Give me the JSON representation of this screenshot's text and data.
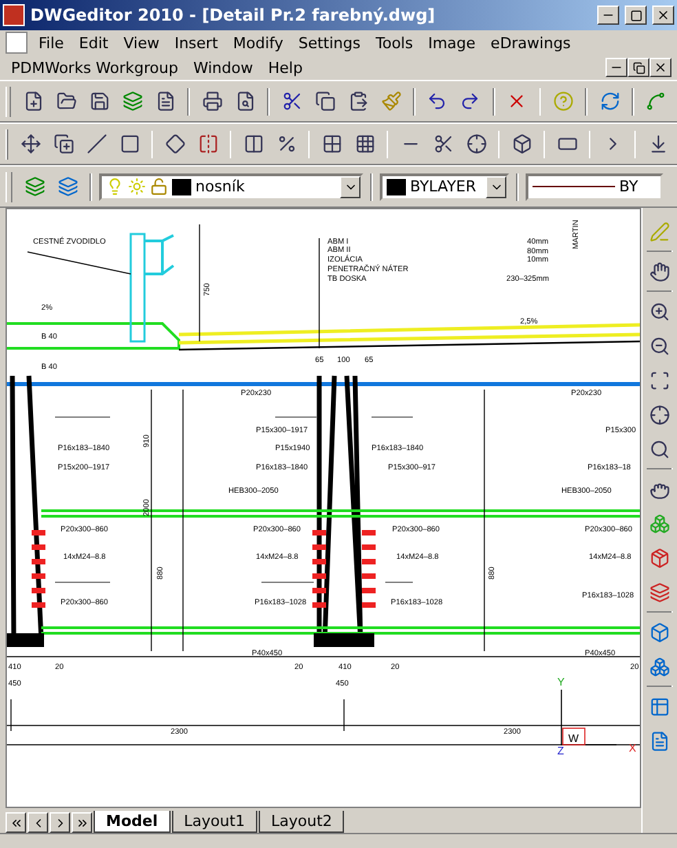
{
  "window": {
    "title": "DWGeditor 2010 - [Detail Pr.2 farebný.dwg]"
  },
  "menu_rows": [
    [
      "File",
      "Edit",
      "View",
      "Insert",
      "Modify",
      "Settings",
      "Tools",
      "Image",
      "eDrawings"
    ],
    [
      "PDMWorks Workgroup",
      "Window",
      "Help"
    ]
  ],
  "properties_bar": {
    "layer": "nosník",
    "color_setting": "BYLAYER",
    "linetype": "BY"
  },
  "drawing": {
    "annotations": [
      "CESTNÉ ZVODIDLO",
      "ABM I",
      "ABM II",
      "IZOLÁCIA",
      "PENETRAČNÝ NÁTER",
      "TB DOSKA",
      "40mm",
      "80mm",
      "10mm",
      "230–325mm",
      "MARTIN",
      "750",
      "2%",
      "2,5%",
      "B 40",
      "B 40",
      "65",
      "100",
      "65",
      "P20x230",
      "P20x230",
      "P15x300–1917",
      "P15x300",
      "P16x183–1840",
      "P15x1940",
      "P16x183–1840",
      "P15x200–1917",
      "P16x183–1840",
      "P15x300–917",
      "P16x183–18",
      "HEB300–2050",
      "HEB300–2050",
      "910",
      "2000",
      "P20x300–860",
      "P20x300–860",
      "P20x300–860",
      "P20x300–860",
      "14xM24–8.8",
      "14xM24–8.8",
      "14xM24–8.8",
      "14xM24–8.8",
      "P20x300–860",
      "P16x183–1028",
      "P16x183–1028",
      "P16x183–1028",
      "880",
      "880",
      "P40x450",
      "P40x450",
      "410",
      "20",
      "20",
      "410",
      "20",
      "20",
      "450",
      "450",
      "2300",
      "2300",
      "Y",
      "X",
      "Z",
      "W"
    ]
  },
  "tabs": [
    {
      "label": "Model",
      "selected": true
    },
    {
      "label": "Layout1",
      "selected": false
    },
    {
      "label": "Layout2",
      "selected": false
    }
  ]
}
